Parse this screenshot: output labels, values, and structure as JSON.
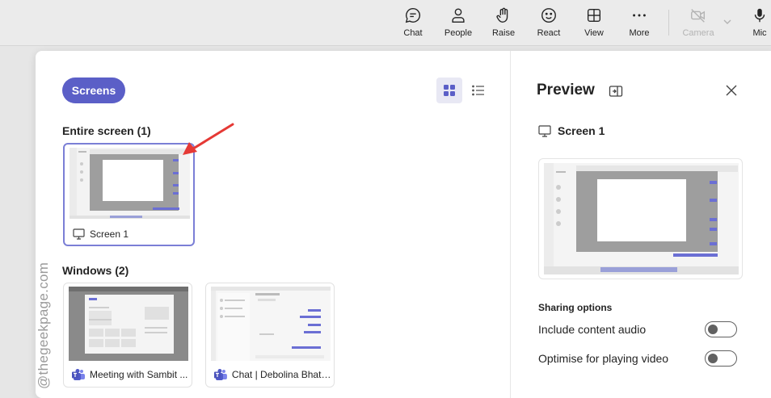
{
  "toolbar": {
    "chat": "Chat",
    "people": "People",
    "raise": "Raise",
    "react": "React",
    "view": "View",
    "more": "More",
    "camera": "Camera",
    "mic": "Mic"
  },
  "dialog": {
    "screens_tab": "Screens",
    "entire_screen_heading": "Entire screen (1)",
    "screen_card_label": "Screen 1",
    "windows_heading": "Windows (2)",
    "windows": [
      {
        "label": "Meeting with Sambit ..."
      },
      {
        "label": "Chat | Debolina Bhatt..."
      }
    ]
  },
  "preview": {
    "title": "Preview",
    "screen_name": "Screen 1",
    "sharing_options_heading": "Sharing options",
    "include_audio_label": "Include content audio",
    "include_audio_on": false,
    "optimise_video_label": "Optimise for playing video",
    "optimise_video_on": false
  },
  "watermark": "@thegeekpage.com",
  "colors": {
    "accent": "#5b5fc7",
    "selected_border": "#7b7fd6",
    "annotation_arrow": "#e53935"
  }
}
